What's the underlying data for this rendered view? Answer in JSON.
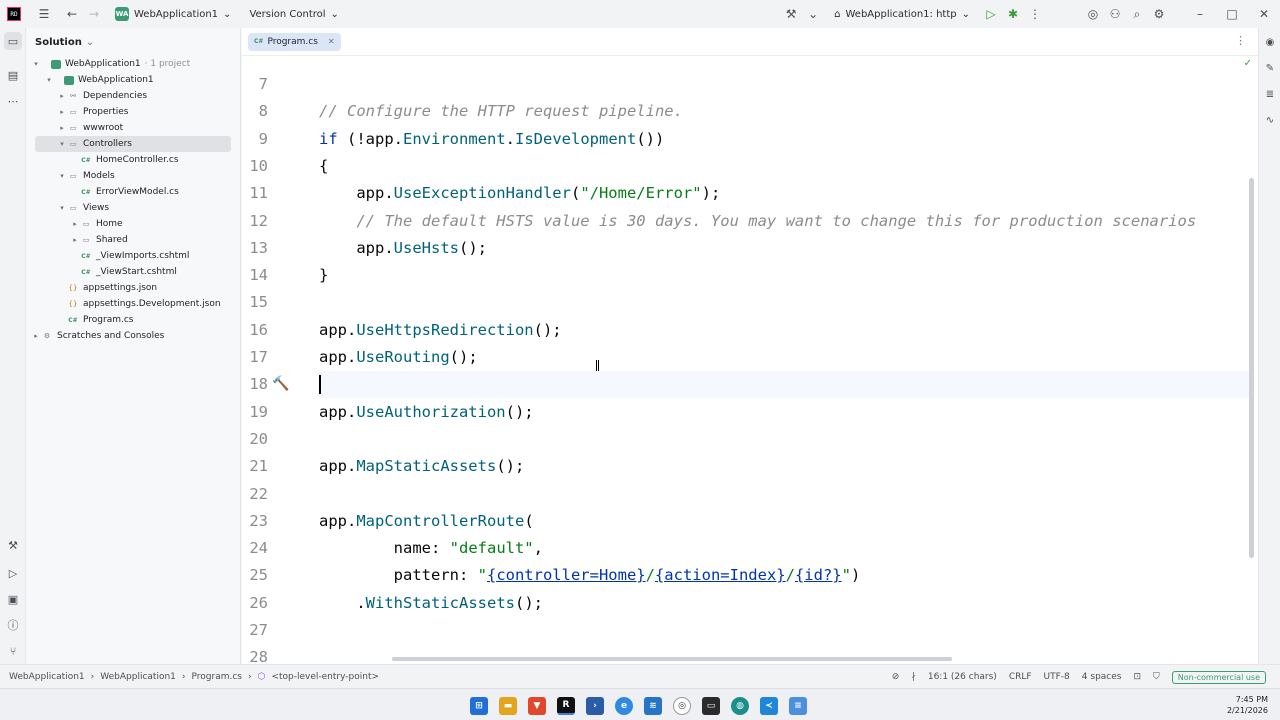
{
  "titlebar": {
    "project_badge": "WA",
    "project_name": "WebApplication1",
    "version_control": "Version Control",
    "run_config": "WebApplication1: http"
  },
  "sidebar": {
    "title": "Solution",
    "tree": [
      {
        "label": "WebApplication1",
        "meta": "· 1 project",
        "depth": 0,
        "arrow": "▾",
        "icon": "solution"
      },
      {
        "label": "WebApplication1",
        "depth": 1,
        "arrow": "▾",
        "icon": "project"
      },
      {
        "label": "Dependencies",
        "depth": 2,
        "arrow": "▸",
        "icon": "deps"
      },
      {
        "label": "Properties",
        "depth": 2,
        "arrow": "▸",
        "icon": "folder"
      },
      {
        "label": "wwwroot",
        "depth": 2,
        "arrow": "▸",
        "icon": "folder"
      },
      {
        "label": "Controllers",
        "depth": 2,
        "arrow": "▾",
        "icon": "folder",
        "selected": true
      },
      {
        "label": "HomeController.cs",
        "depth": 3,
        "arrow": "",
        "icon": "cs"
      },
      {
        "label": "Models",
        "depth": 2,
        "arrow": "▾",
        "icon": "folder"
      },
      {
        "label": "ErrorViewModel.cs",
        "depth": 3,
        "arrow": "",
        "icon": "cs"
      },
      {
        "label": "Views",
        "depth": 2,
        "arrow": "▾",
        "icon": "folder"
      },
      {
        "label": "Home",
        "depth": 3,
        "arrow": "▸",
        "icon": "folder"
      },
      {
        "label": "Shared",
        "depth": 3,
        "arrow": "▸",
        "icon": "folder"
      },
      {
        "label": "_ViewImports.cshtml",
        "depth": 3,
        "arrow": "",
        "icon": "cs"
      },
      {
        "label": "_ViewStart.cshtml",
        "depth": 3,
        "arrow": "",
        "icon": "cs"
      },
      {
        "label": "appsettings.json",
        "depth": 2,
        "arrow": "",
        "icon": "json"
      },
      {
        "label": "appsettings.Development.json",
        "depth": 2,
        "arrow": "",
        "icon": "json"
      },
      {
        "label": "Program.cs",
        "depth": 2,
        "arrow": "",
        "icon": "cs"
      },
      {
        "label": "Scratches and Consoles",
        "depth": 0,
        "arrow": "▸",
        "icon": "scratch"
      }
    ]
  },
  "editor": {
    "tab_icon": "C#",
    "tab_label": "Program.cs",
    "caret_line": 18,
    "lines": [
      {
        "n": "7",
        "tokens": []
      },
      {
        "n": "8",
        "tokens": [
          {
            "t": "// Configure the HTTP request pipeline.",
            "c": "cmt"
          }
        ]
      },
      {
        "n": "9",
        "tokens": [
          {
            "t": "if",
            "c": "kw"
          },
          {
            "t": " (!app.",
            "c": ""
          },
          {
            "t": "Environment",
            "c": "fn"
          },
          {
            "t": ".",
            "c": ""
          },
          {
            "t": "IsDevelopment",
            "c": "fn"
          },
          {
            "t": "())",
            "c": ""
          }
        ]
      },
      {
        "n": "10",
        "tokens": [
          {
            "t": "{",
            "c": ""
          }
        ]
      },
      {
        "n": "11",
        "tokens": [
          {
            "t": "    app.",
            "c": ""
          },
          {
            "t": "UseExceptionHandler",
            "c": "fn"
          },
          {
            "t": "(",
            "c": ""
          },
          {
            "t": "\"/Home/Error\"",
            "c": "str"
          },
          {
            "t": ");",
            "c": ""
          }
        ]
      },
      {
        "n": "12",
        "tokens": [
          {
            "t": "    // The default HSTS value is 30 days. You may want to change this for production scenarios",
            "c": "cmt"
          }
        ]
      },
      {
        "n": "13",
        "tokens": [
          {
            "t": "    app.",
            "c": ""
          },
          {
            "t": "UseHsts",
            "c": "fn"
          },
          {
            "t": "();",
            "c": ""
          }
        ]
      },
      {
        "n": "14",
        "tokens": [
          {
            "t": "}",
            "c": ""
          }
        ]
      },
      {
        "n": "15",
        "tokens": []
      },
      {
        "n": "16",
        "tokens": [
          {
            "t": "app.",
            "c": ""
          },
          {
            "t": "UseHttpsRedirection",
            "c": "fn"
          },
          {
            "t": "();",
            "c": ""
          }
        ]
      },
      {
        "n": "17",
        "tokens": [
          {
            "t": "app.",
            "c": ""
          },
          {
            "t": "UseRouting",
            "c": "fn"
          },
          {
            "t": "();",
            "c": ""
          }
        ]
      },
      {
        "n": "18",
        "tokens": []
      },
      {
        "n": "19",
        "tokens": [
          {
            "t": "app.",
            "c": ""
          },
          {
            "t": "UseAuthorization",
            "c": "fn"
          },
          {
            "t": "();",
            "c": ""
          }
        ]
      },
      {
        "n": "20",
        "tokens": []
      },
      {
        "n": "21",
        "tokens": [
          {
            "t": "app.",
            "c": ""
          },
          {
            "t": "MapStaticAssets",
            "c": "fn"
          },
          {
            "t": "();",
            "c": ""
          }
        ]
      },
      {
        "n": "22",
        "tokens": []
      },
      {
        "n": "23",
        "tokens": [
          {
            "t": "app.",
            "c": ""
          },
          {
            "t": "MapControllerRoute",
            "c": "fn"
          },
          {
            "t": "(",
            "c": ""
          }
        ]
      },
      {
        "n": "24",
        "tokens": [
          {
            "t": "        name: ",
            "c": ""
          },
          {
            "t": "\"default\"",
            "c": "str"
          },
          {
            "t": ",",
            "c": ""
          }
        ]
      },
      {
        "n": "25",
        "tokens": [
          {
            "t": "        pattern: ",
            "c": ""
          },
          {
            "t": "\"",
            "c": "str"
          },
          {
            "t": "{controller=Home}",
            "c": "kw uline"
          },
          {
            "t": "/",
            "c": "str"
          },
          {
            "t": "{action=Index}",
            "c": "kw uline"
          },
          {
            "t": "/",
            "c": "str"
          },
          {
            "t": "{id?}",
            "c": "kw uline"
          },
          {
            "t": "\"",
            "c": "str"
          },
          {
            "t": ")",
            "c": ""
          }
        ]
      },
      {
        "n": "26",
        "tokens": [
          {
            "t": "    .",
            "c": ""
          },
          {
            "t": "WithStaticAssets",
            "c": "fn"
          },
          {
            "t": "();",
            "c": ""
          }
        ]
      },
      {
        "n": "27",
        "tokens": []
      },
      {
        "n": "28",
        "tokens": []
      }
    ]
  },
  "statusbar": {
    "crumbs": [
      "WebApplication1",
      "WebApplication1",
      "Program.cs",
      "<top-level-entry-point>"
    ],
    "position": "16:1 (26 chars)",
    "line_ending": "CRLF",
    "encoding": "UTF-8",
    "indent": "4 spaces",
    "license": "Non-commercial use"
  },
  "taskbar": {
    "time": "7:45 PM",
    "date": "2/21/2026"
  },
  "colors": {
    "keyword": "#0033b3",
    "method": "#00627a",
    "string": "#067d17",
    "comment": "#8c8c8c",
    "accent": "#3c9b74"
  }
}
